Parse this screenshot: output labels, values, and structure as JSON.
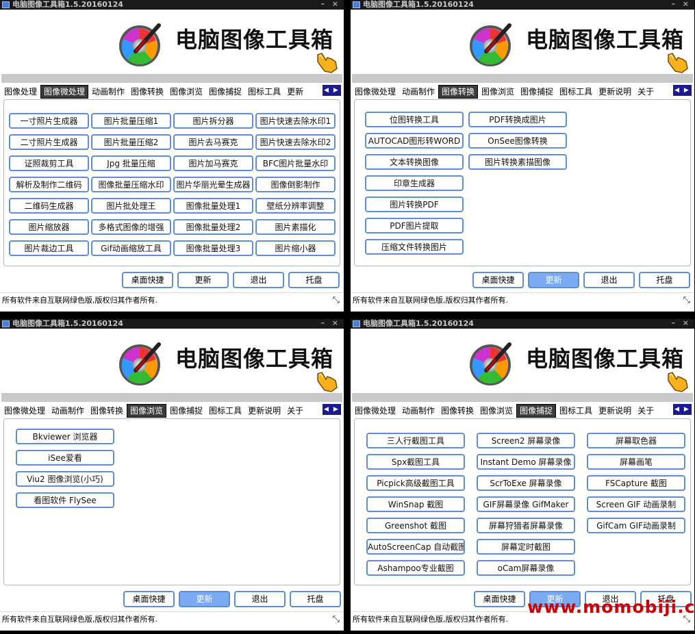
{
  "app_title": "电脑图像工具箱1.5.20160124",
  "brand": "电脑图像工具箱",
  "title_min": "–",
  "title_close": "×",
  "status_text": "所有软件来自互联网绿色版,版权归其作者所有.",
  "grip_symbol": "⤡",
  "tab_nav": "◀ ▶",
  "bottom_buttons": [
    "桌面快捷",
    "更新",
    "退出",
    "托盘"
  ],
  "watermark": "www.momobiji.com",
  "colors": {
    "accent": "#5b8ed6",
    "highlight": "#7aaaf0",
    "tab_active": "#3b3b3b",
    "watermark": "#cc0000"
  },
  "windows": {
    "w1": {
      "tabs": [
        "图像处理",
        "图像微处理",
        "动画制作",
        "图像转换",
        "图像浏览",
        "图像捕捉",
        "图标工具",
        "更新"
      ],
      "active_tab": 1,
      "columns": [
        [
          "一寸照片生成器",
          "二寸照片生成器",
          "证照裁剪工具",
          "解析及制作二维码",
          "二维码生成器",
          "图片缩放器",
          "图片裁边工具"
        ],
        [
          "图片批量压缩1",
          "图片批量压缩2",
          "Jpg 批量压缩",
          "图像批量压缩水印",
          "图片批处理王",
          "多格式图像的增强",
          "Gif动画缩放工具"
        ],
        [
          "图片拆分器",
          "图片去马赛克",
          "图片加马赛克",
          "图片华丽光晕生成器",
          "图像批量处理1",
          "图像批量处理2",
          "图像批量处理3"
        ],
        [
          "图片快速去除水印1",
          "图片快速去除水印2",
          "BFC图片批量水印",
          "图像倒影制作",
          "壁纸分辨率调整",
          "图片素描化",
          "图片缩小器"
        ]
      ]
    },
    "w2": {
      "tabs": [
        "图像微处理",
        "动画制作",
        "图像转换",
        "图像浏览",
        "图像捕捉",
        "图标工具",
        "更新说明",
        "关于"
      ],
      "active_tab": 2,
      "columns": [
        [
          "位图转换工具",
          "AUTOCAD图形转WORD",
          "文本转换图像",
          "印章生成器",
          "图片转换PDF",
          "PDF图片提取",
          "压缩文件转换图片"
        ],
        [
          "PDF转换成图片",
          "OnSee图像转换",
          "图片转换素描图像"
        ]
      ]
    },
    "w3": {
      "tabs": [
        "图像微处理",
        "动画制作",
        "图像转换",
        "图像浏览",
        "图像捕捉",
        "图标工具",
        "更新说明",
        "关于"
      ],
      "active_tab": 3,
      "columns": [
        [
          "Bkviewer 浏览器",
          "iSee爱看",
          "Viu2 图像浏览(小巧)",
          "看图软件 FlySee"
        ]
      ]
    },
    "w4": {
      "tabs": [
        "图像微处理",
        "动画制作",
        "图像转换",
        "图像浏览",
        "图像捕捉",
        "图标工具",
        "更新说明",
        "关于"
      ],
      "active_tab": 4,
      "columns": [
        [
          "三人行截图工具",
          "Spx截图工具",
          "Picpick高级截图工具",
          "WinSnap 截图",
          "Greenshot 截图",
          "AutoScreenCap 自动截图",
          "Ashampoo专业截图"
        ],
        [
          "Screen2 屏幕录像",
          "Instant Demo 屏幕录像",
          "ScrToExe 屏幕录像",
          "GIF屏幕录像 GifMaker",
          "屏幕狩猎者屏幕录像",
          "屏幕定时截图",
          "oCam屏幕录像"
        ],
        [
          "屏幕取色器",
          "屏幕画笔",
          "FSCapture 截图",
          "Screen GIF 动画录制",
          "GifCam GIF动画录制"
        ]
      ]
    }
  }
}
